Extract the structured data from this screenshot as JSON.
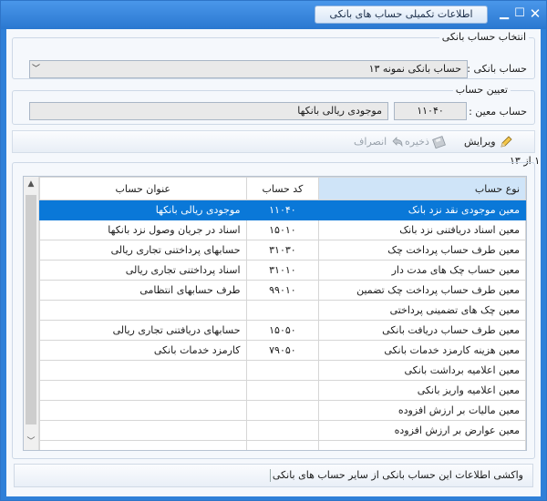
{
  "window": {
    "title": "اطلاعات تکمیلی حساب های بانکی"
  },
  "bank_section": {
    "title": "انتخاب حساب بانکی",
    "label": "حساب بانکی :",
    "selected": "حساب بانکی نمونه ۱۳"
  },
  "account_section": {
    "title": "تعیین حساب",
    "label": "حساب معین :",
    "code": "۱۱۰۴۰",
    "name": "موجودی ریالی بانکها"
  },
  "toolbar": {
    "edit_label": "ویرایش",
    "save_label": "ذخیره",
    "cancel_label": "انصراف"
  },
  "counter": "۱ از ۱۳",
  "grid": {
    "columns": [
      "نوع حساب",
      "کد حساب",
      "عنوان حساب"
    ],
    "rows": [
      [
        "معین موجودی نقد نزد بانک",
        "۱۱۰۴۰",
        "موجودی ریالی بانکها"
      ],
      [
        "معین اسناد دریافتنی نزد بانک",
        "۱۵۰۱۰",
        "اسناد در جریان وصول نزد بانکها"
      ],
      [
        "معین طرف حساب پرداخت چک",
        "۳۱۰۳۰",
        "حسابهای پرداختنی تجاری ریالی"
      ],
      [
        "معین حساب چک های مدت دار",
        "۳۱۰۱۰",
        "اسناد پرداختنی تجاری ریالی"
      ],
      [
        "معین طرف حساب پرداخت چک تضمین",
        "۹۹۰۱۰",
        "طرف حسابهای انتظامی"
      ],
      [
        "معین چک های تضمینی پرداختی",
        "",
        ""
      ],
      [
        "معین طرف حساب دریافت بانکی",
        "۱۵۰۵۰",
        "حسابهای دریافتنی تجاری ریالی"
      ],
      [
        "معین هزینه کارمزد خدمات بانکی",
        "۷۹۰۵۰",
        "کارمزد خدمات بانکی"
      ],
      [
        "معین اعلامیه برداشت بانکی",
        "",
        ""
      ],
      [
        "معین اعلامیه واریز بانکی",
        "",
        ""
      ],
      [
        "معین مالیات بر ارزش افزوده",
        "",
        ""
      ],
      [
        "معین عوارض بر ارزش افزوده",
        "",
        ""
      ],
      [
        "",
        "",
        ""
      ]
    ]
  },
  "bottom": {
    "fetch_label": "واکشی اطلاعات این حساب بانکی از سایر حساب های بانکی"
  },
  "icons": {
    "minimize": "minimize-icon",
    "maximize": "maximize-icon",
    "close": "close-icon",
    "edit": "pencil-icon",
    "save": "save-icon",
    "cancel": "undo-icon"
  },
  "colors": {
    "accent": "#0a78d8",
    "titlebar": "#2f80d8"
  }
}
